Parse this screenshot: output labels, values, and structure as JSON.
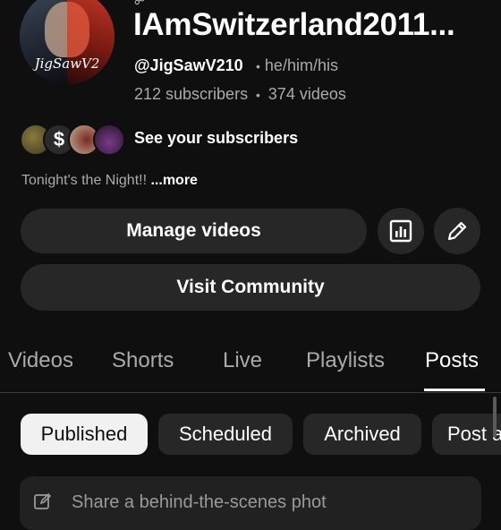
{
  "channel": {
    "name": "IAmSwitzerland2011...",
    "handle": "@JigSawV210",
    "pronouns": "he/him/his",
    "subscribers": "212 subscribers",
    "videos": "374 videos",
    "avatar_caption": "JigSawV2",
    "description": "Tonight's the Night!!",
    "more_label": "...more"
  },
  "subscribers_row": {
    "label": "See your subscribers",
    "badge_glyph": "$"
  },
  "buttons": {
    "manage_videos": "Manage videos",
    "visit_community": "Visit Community"
  },
  "tabs": [
    {
      "label": "Videos"
    },
    {
      "label": "Shorts"
    },
    {
      "label": "Live"
    },
    {
      "label": "Playlists"
    },
    {
      "label": "Posts",
      "active": true
    }
  ],
  "filters": [
    {
      "label": "Published",
      "selected": true
    },
    {
      "label": "Scheduled"
    },
    {
      "label": "Archived"
    },
    {
      "label": "Post a"
    }
  ],
  "composer": {
    "placeholder": "Share a behind-the-scenes phot"
  },
  "colors": {
    "background": "#0f0f0f",
    "surface": "#272727",
    "text": "#f1f1f1",
    "secondary": "#aaaaaa"
  }
}
